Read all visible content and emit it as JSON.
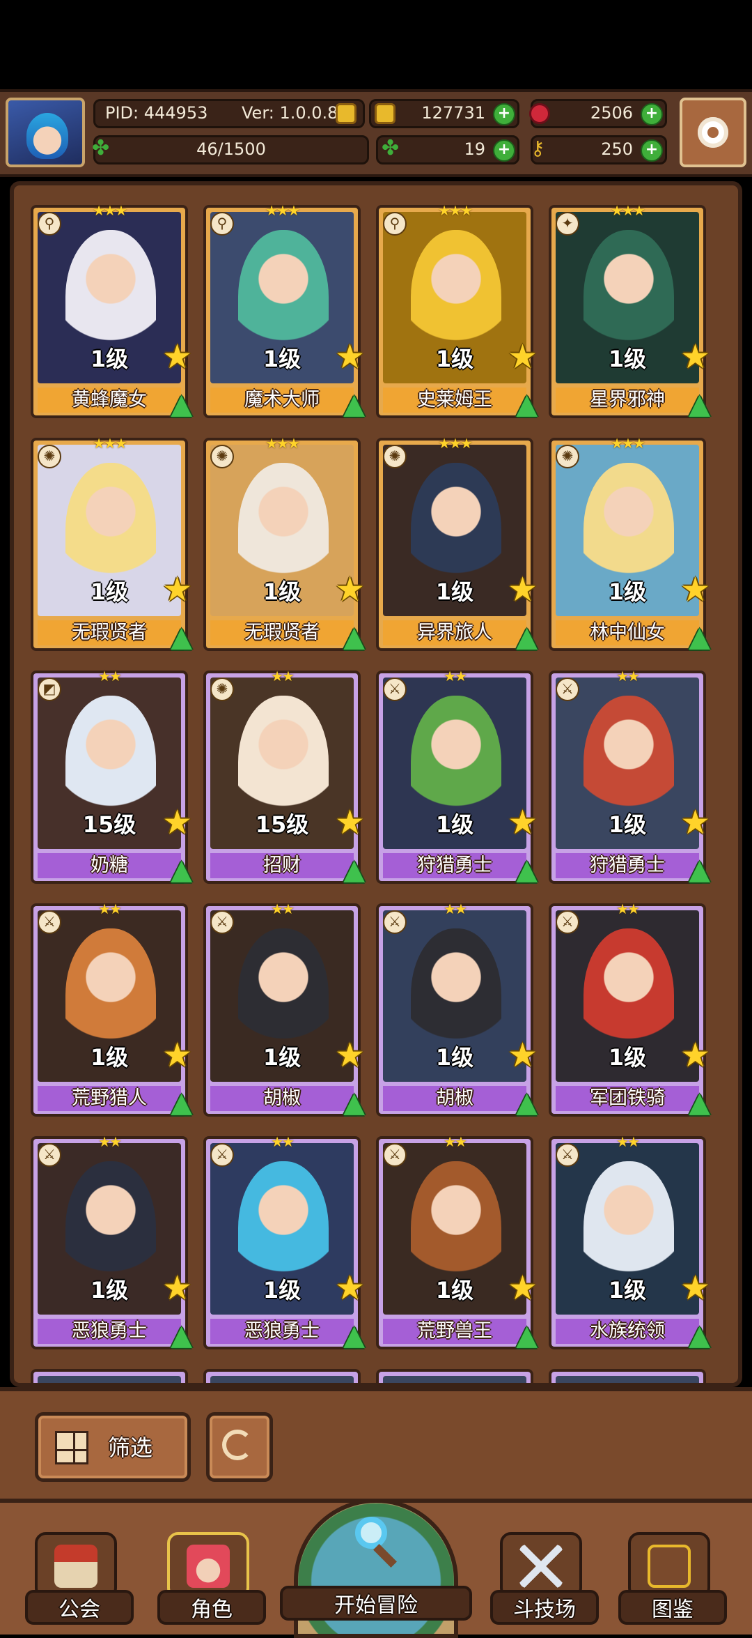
{
  "header": {
    "pid": "PID: 444953",
    "version": "Ver: 1.0.0.8",
    "gold": "127731",
    "gems": "2506",
    "stamina": "46/1500",
    "clover": "19",
    "keys": "250"
  },
  "cards": [
    {
      "name": "黄蜂魔女",
      "level": "1级",
      "rarity": "gold",
      "stars": "★★★",
      "cls": "⚲",
      "tint": "#2b2d55",
      "skin": "#e8e6ef"
    },
    {
      "name": "魔术大师",
      "level": "1级",
      "rarity": "gold",
      "stars": "★★★",
      "cls": "⚲",
      "tint": "#3c4b6e",
      "skin": "#4fb39a"
    },
    {
      "name": "史莱姆王",
      "level": "1级",
      "rarity": "gold",
      "stars": "★★★",
      "cls": "⚲",
      "tint": "#a07310",
      "skin": "#f0c232"
    },
    {
      "name": "星界邪神",
      "level": "1级",
      "rarity": "gold",
      "stars": "★★★",
      "cls": "✦",
      "tint": "#1f3b33",
      "skin": "#2f6a55"
    },
    {
      "name": "无瑕贤者",
      "level": "1级",
      "rarity": "gold",
      "stars": "★★★",
      "cls": "✺",
      "tint": "#d8d6e8",
      "skin": "#f4dc8a"
    },
    {
      "name": "无瑕贤者",
      "level": "1级",
      "rarity": "gold",
      "stars": "★★★",
      "cls": "✺",
      "tint": "#d7a35a",
      "skin": "#efe6da"
    },
    {
      "name": "异界旅人",
      "level": "1级",
      "rarity": "gold",
      "stars": "★★★",
      "cls": "✺",
      "tint": "#3a2a24",
      "skin": "#2d3a55"
    },
    {
      "name": "林中仙女",
      "level": "1级",
      "rarity": "gold",
      "stars": "★★★",
      "cls": "✺",
      "tint": "#6aa9c7",
      "skin": "#f2da8c"
    },
    {
      "name": "奶糖",
      "level": "15级",
      "rarity": "purple",
      "stars": "★★",
      "cls": "◩",
      "tint": "#47302a",
      "skin": "#dfe7f2"
    },
    {
      "name": "招财",
      "level": "15级",
      "rarity": "purple",
      "stars": "★★",
      "cls": "✺",
      "tint": "#4a3526",
      "skin": "#f3e4d2"
    },
    {
      "name": "狩猎勇士",
      "level": "1级",
      "rarity": "purple",
      "stars": "★★",
      "cls": "⚔",
      "tint": "#2e3652",
      "skin": "#5fa84a"
    },
    {
      "name": "狩猎勇士",
      "level": "1级",
      "rarity": "purple",
      "stars": "★★",
      "cls": "⚔",
      "tint": "#3a4660",
      "skin": "#c54a36"
    },
    {
      "name": "荒野猎人",
      "level": "1级",
      "rarity": "purple",
      "stars": "★★",
      "cls": "⚔",
      "tint": "#3c2a22",
      "skin": "#d07b3a"
    },
    {
      "name": "胡椒",
      "level": "1级",
      "rarity": "purple",
      "stars": "★★",
      "cls": "⚔",
      "tint": "#3a2a22",
      "skin": "#2d2d33"
    },
    {
      "name": "胡椒",
      "level": "1级",
      "rarity": "purple",
      "stars": "★★",
      "cls": "⚔",
      "tint": "#33405c",
      "skin": "#2d2d33"
    },
    {
      "name": "军团铁骑",
      "level": "1级",
      "rarity": "purple",
      "stars": "★★",
      "cls": "⚔",
      "tint": "#2e2a30",
      "skin": "#c73a2f"
    },
    {
      "name": "恶狼勇士",
      "level": "1级",
      "rarity": "purple",
      "stars": "★★",
      "cls": "⚔",
      "tint": "#3b2a26",
      "skin": "#2b2f3e"
    },
    {
      "name": "恶狼勇士",
      "level": "1级",
      "rarity": "purple",
      "stars": "★★",
      "cls": "⚔",
      "tint": "#2e3b60",
      "skin": "#45b9e0"
    },
    {
      "name": "荒野兽王",
      "level": "1级",
      "rarity": "purple",
      "stars": "★★",
      "cls": "⚔",
      "tint": "#3a2a22",
      "skin": "#a35a2c"
    },
    {
      "name": "水族统领",
      "level": "1级",
      "rarity": "purple",
      "stars": "★★",
      "cls": "⚔",
      "tint": "#24364a",
      "skin": "#dfe6ef"
    }
  ],
  "filter": {
    "label": "筛选"
  },
  "nav": {
    "guild": "公会",
    "character": "角色",
    "adventure": "开始冒险",
    "arena": "斗技场",
    "codex": "图鉴"
  }
}
